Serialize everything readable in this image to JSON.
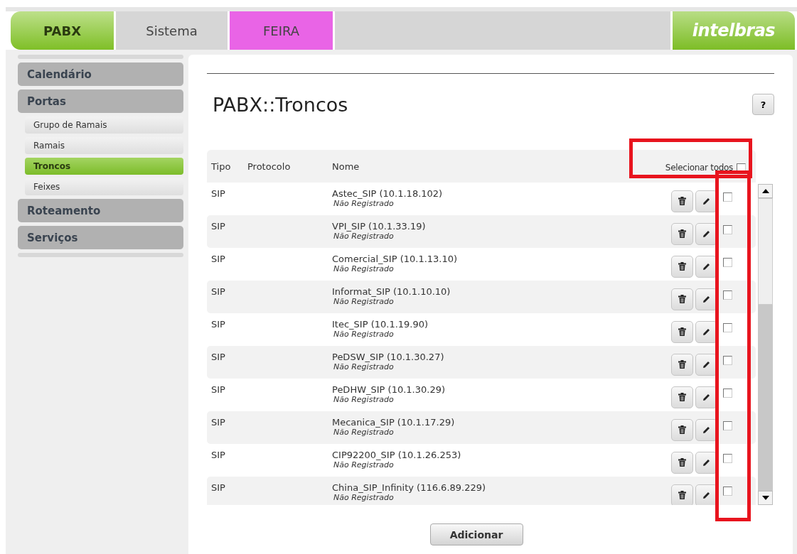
{
  "tabs": [
    {
      "label": "PABX",
      "selected": true
    },
    {
      "label": "Sistema",
      "selected": false
    },
    {
      "label": "FEIRA",
      "selected": false,
      "color": "#e964e6"
    }
  ],
  "logo": "intelbras",
  "sidebar": {
    "items": [
      {
        "label": "Calendário",
        "selected": false
      },
      {
        "label": "Portas",
        "selected": false,
        "children": [
          {
            "label": "Grupo de Ramais",
            "selected": false
          },
          {
            "label": "Ramais",
            "selected": false
          },
          {
            "label": "Troncos",
            "selected": true
          },
          {
            "label": "Feixes",
            "selected": false
          }
        ]
      },
      {
        "label": "Roteamento",
        "selected": false
      },
      {
        "label": "Serviços",
        "selected": false
      }
    ]
  },
  "page_title": "PABX::Troncos",
  "help_button": "?",
  "table": {
    "columns": [
      "Tipo",
      "Protocolo",
      "Nome"
    ],
    "select_all": {
      "label": "Selecionar todos",
      "checked": false
    },
    "rows": [
      {
        "type": "SIP",
        "name": "Astec_SIP (10.1.18.102)",
        "status": "Não Registrado",
        "checked": false
      },
      {
        "type": "SIP",
        "name": "VPI_SIP (10.1.33.19)",
        "status": "Não Registrado",
        "checked": false
      },
      {
        "type": "SIP",
        "name": "Comercial_SIP (10.1.13.10)",
        "status": "Não Registrado",
        "checked": false
      },
      {
        "type": "SIP",
        "name": "Informat_SIP (10.1.10.10)",
        "status": "Não Registrado",
        "checked": false
      },
      {
        "type": "SIP",
        "name": "Itec_SIP (10.1.19.90)",
        "status": "Não Registrado",
        "checked": false
      },
      {
        "type": "SIP",
        "name": "PeDSW_SIP (10.1.30.27)",
        "status": "Não Registrado",
        "checked": false
      },
      {
        "type": "SIP",
        "name": "PeDHW_SIP (10.1.30.29)",
        "status": "Não Registrado",
        "checked": false
      },
      {
        "type": "SIP",
        "name": "Mecanica_SIP (10.1.17.29)",
        "status": "Não Registrado",
        "checked": false
      },
      {
        "type": "SIP",
        "name": "CIP92200_SIP (10.1.26.253)",
        "status": "Não Registrado",
        "checked": false
      },
      {
        "type": "SIP",
        "name": "China_SIP_Infinity (116.6.89.229)",
        "status": "Não Registrado",
        "checked": false
      }
    ]
  },
  "add_button": "Adicionar"
}
